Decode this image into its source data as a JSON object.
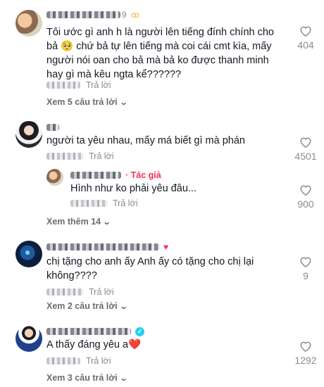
{
  "comments": [
    {
      "username_suffix": "9",
      "text": "Tôi ước gì anh h     là người lên tiếng đính chính cho bả 🥺  chứ bả tự lên tiếng mà coi cái cmt kìa, mấy người nói oan cho bả mà bả ko được thanh minh hay gì mà kêu ngta kể??????",
      "reply_label": "Trả lời",
      "likes": "404",
      "view_more": "Xem 5 câu trả lời"
    },
    {
      "text": "người ta yêu nhau, mấy má biết gì mà phán",
      "reply_label": "Trả lời",
      "likes": "4501",
      "reply": {
        "author_tag": "· Tác giả",
        "text": "Hình như ko phải yêu đâu...",
        "reply_label": "Trả lời",
        "likes": "900"
      },
      "view_more": "Xem thêm 14"
    },
    {
      "text": "chị tặng cho anh ấy Anh ấy có tặng cho chị lại không????",
      "reply_label": "Trả lời",
      "likes": "9",
      "view_more": "Xem 2 câu trả lời"
    },
    {
      "text": "A thấy đáng yêu a❤️",
      "reply_label": "Trả lời",
      "likes": "1292",
      "view_more": "Xem 3 câu trả lời"
    }
  ],
  "icons": {
    "like": "heart-outline-icon",
    "chevron": "chevron-down-icon",
    "verified": "verified-badge-icon"
  },
  "colors": {
    "accent": "#fe2c55",
    "muted": "#8a8b91",
    "verified": "#20d5ec"
  }
}
